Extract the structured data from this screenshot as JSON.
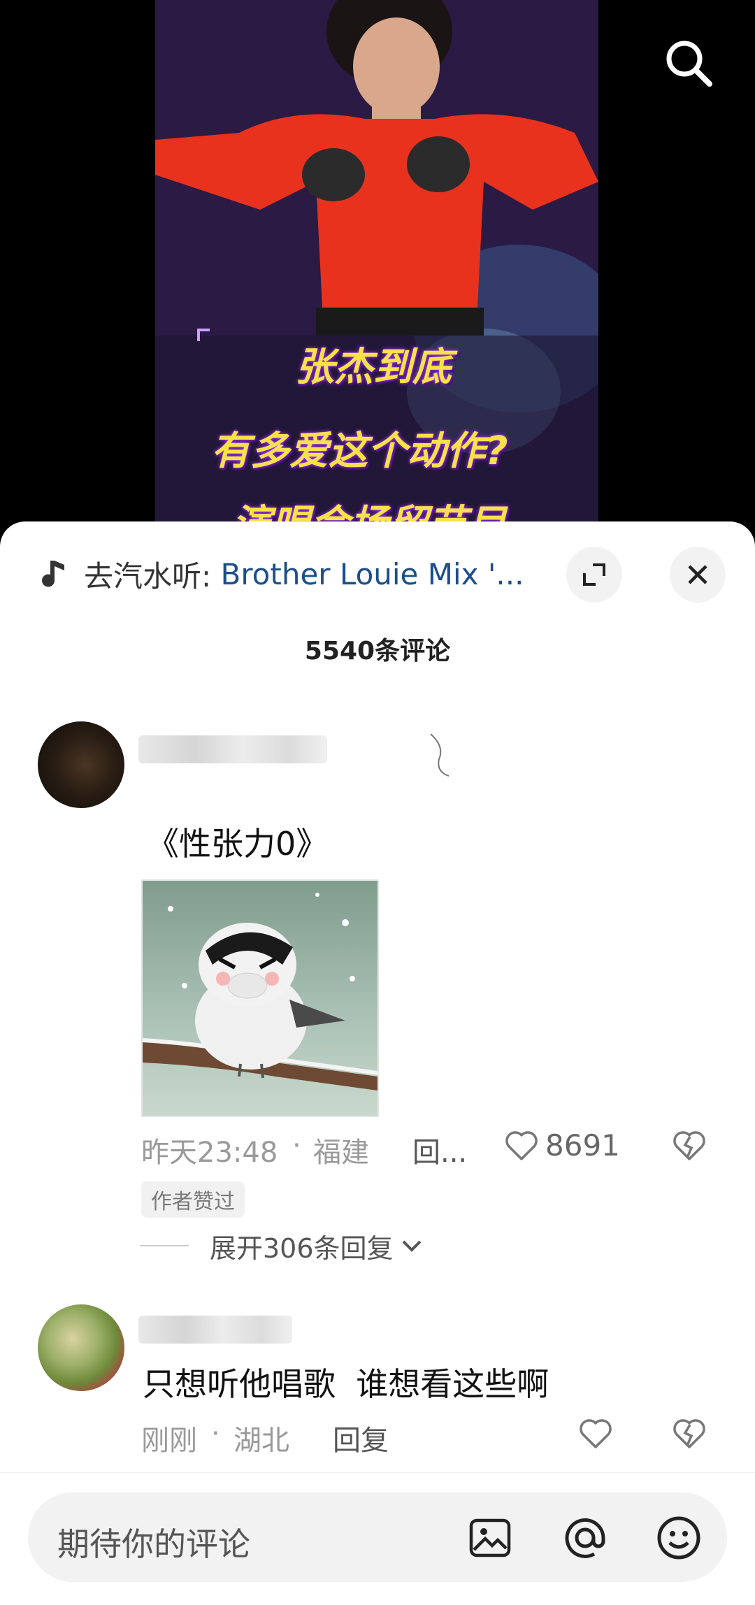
{
  "video": {
    "caption_lines": [
      "张杰到底",
      "有多爱这个动作?",
      "演唱会场留节目"
    ]
  },
  "music": {
    "prefix": "去汽水听: ",
    "title": "Brother Louie Mix '..."
  },
  "comments_header": {
    "count_label": "5540条评论"
  },
  "comments": [
    {
      "text": "《性张力0》",
      "time": "昨天23:48",
      "location": "福建",
      "reply_label": "回...",
      "likes": "8691",
      "author_tag": "作者赞过",
      "expand_label": "展开306条回复"
    },
    {
      "text": "只想听他唱歌  谁想看这些啊",
      "time": "刚刚",
      "location": "湖北",
      "reply_label": "回复"
    }
  ],
  "input": {
    "placeholder": "期待你的评论"
  },
  "colors": {
    "music_title": "#1d4e89",
    "caption": "#f6e24a",
    "sheet": "#ffffff"
  },
  "icons": [
    "search-icon",
    "music-note-icon",
    "expand-icon",
    "close-icon",
    "heart-icon",
    "dislike-icon",
    "chevron-down-icon",
    "image-icon",
    "at-icon",
    "emoji-icon"
  ]
}
